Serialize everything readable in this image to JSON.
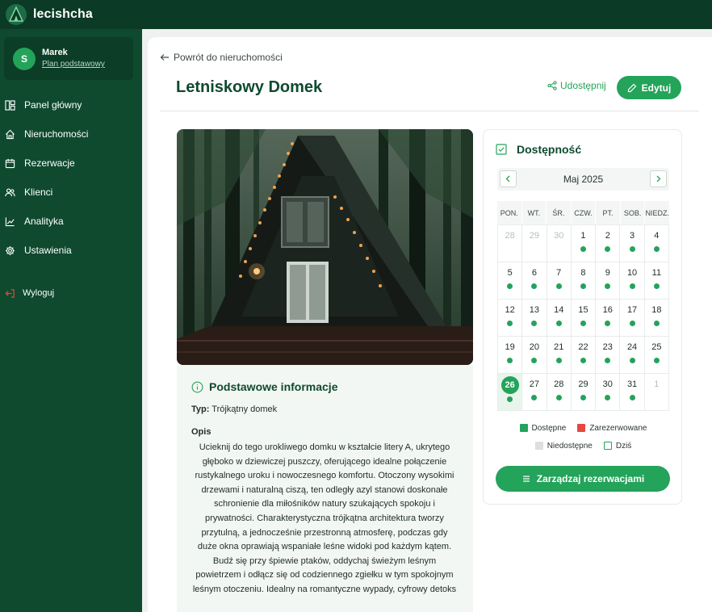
{
  "app": {
    "brand": "lecishcha",
    "logo_icon": "tent-logo-icon",
    "accent_color": "#24a35a",
    "dark_color": "#0f4a2f"
  },
  "user": {
    "initial": "S",
    "name": "Marek",
    "plan": "Plan podstawowy"
  },
  "sidebar": {
    "items": [
      {
        "label": "Panel główny",
        "icon": "dashboard-icon"
      },
      {
        "label": "Nieruchomości",
        "icon": "home-icon"
      },
      {
        "label": "Rezerwacje",
        "icon": "calendar-icon"
      },
      {
        "label": "Klienci",
        "icon": "users-icon"
      },
      {
        "label": "Analityka",
        "icon": "chart-icon"
      },
      {
        "label": "Ustawienia",
        "icon": "gear-icon"
      }
    ],
    "logout": "Wyloguj"
  },
  "header": {
    "back": "Powrót do nieruchomości",
    "title": "Letniskowy Domek",
    "share": "Udostępnij",
    "edit": "Edytuj"
  },
  "info": {
    "heading": "Podstawowe informacje",
    "type_label": "Typ:",
    "type_value": "Trójkątny domek",
    "desc_label": "Opis",
    "desc_text": "Ucieknij do tego urokliwego domku w kształcie litery A, ukrytego głęboko w dziewiczej puszczy, oferującego idealne połączenie rustykalnego uroku i nowoczesnego komfortu. Otoczony wysokimi drzewami i naturalną ciszą, ten odległy azyl stanowi doskonałe schronienie dla miłośników natury szukających spokoju i prywatności. Charakterystyczna trójkątna architektura tworzy przytulną, a jednocześnie przestronną atmosferę, podczas gdy duże okna oprawiają wspaniałe leśne widoki pod każdym kątem. Budź się przy śpiewie ptaków, oddychaj świeżym leśnym powietrzem i odłącz się od codziennego zgiełku w tym spokojnym leśnym otoczeniu. Idealny na romantyczne wypady, cyfrowy detoks"
  },
  "availability": {
    "title": "Dostępność",
    "month": "Maj 2025",
    "weekdays": [
      "PON.",
      "WT.",
      "ŚR.",
      "CZW.",
      "PT.",
      "SOB.",
      "NIEDZ."
    ],
    "days": [
      {
        "n": "28",
        "other": true,
        "dot": false
      },
      {
        "n": "29",
        "other": true,
        "dot": false
      },
      {
        "n": "30",
        "other": true,
        "dot": false
      },
      {
        "n": "1",
        "dot": true
      },
      {
        "n": "2",
        "dot": true
      },
      {
        "n": "3",
        "dot": true
      },
      {
        "n": "4",
        "dot": true
      },
      {
        "n": "5",
        "dot": true
      },
      {
        "n": "6",
        "dot": true
      },
      {
        "n": "7",
        "dot": true
      },
      {
        "n": "8",
        "dot": true
      },
      {
        "n": "9",
        "dot": true
      },
      {
        "n": "10",
        "dot": true
      },
      {
        "n": "11",
        "dot": true
      },
      {
        "n": "12",
        "dot": true
      },
      {
        "n": "13",
        "dot": true
      },
      {
        "n": "14",
        "dot": true
      },
      {
        "n": "15",
        "dot": true
      },
      {
        "n": "16",
        "dot": true
      },
      {
        "n": "17",
        "dot": true
      },
      {
        "n": "18",
        "dot": true
      },
      {
        "n": "19",
        "dot": true
      },
      {
        "n": "20",
        "dot": true
      },
      {
        "n": "21",
        "dot": true
      },
      {
        "n": "22",
        "dot": true
      },
      {
        "n": "23",
        "dot": true
      },
      {
        "n": "24",
        "dot": true
      },
      {
        "n": "25",
        "dot": true
      },
      {
        "n": "26",
        "dot": true,
        "today": true
      },
      {
        "n": "27",
        "dot": true
      },
      {
        "n": "28",
        "dot": true
      },
      {
        "n": "29",
        "dot": true
      },
      {
        "n": "30",
        "dot": true
      },
      {
        "n": "31",
        "dot": true
      },
      {
        "n": "1",
        "other": true,
        "dot": false
      }
    ],
    "legend": {
      "available": "Dostępne",
      "reserved": "Zarezerwowane",
      "unavailable": "Niedostępne",
      "today": "Dziś"
    },
    "legend_colors": {
      "available": "#24a35a",
      "reserved": "#e5483d",
      "unavailable": "#dedede",
      "today": "#24a35a"
    },
    "manage": "Zarządzaj rezerwacjami"
  }
}
